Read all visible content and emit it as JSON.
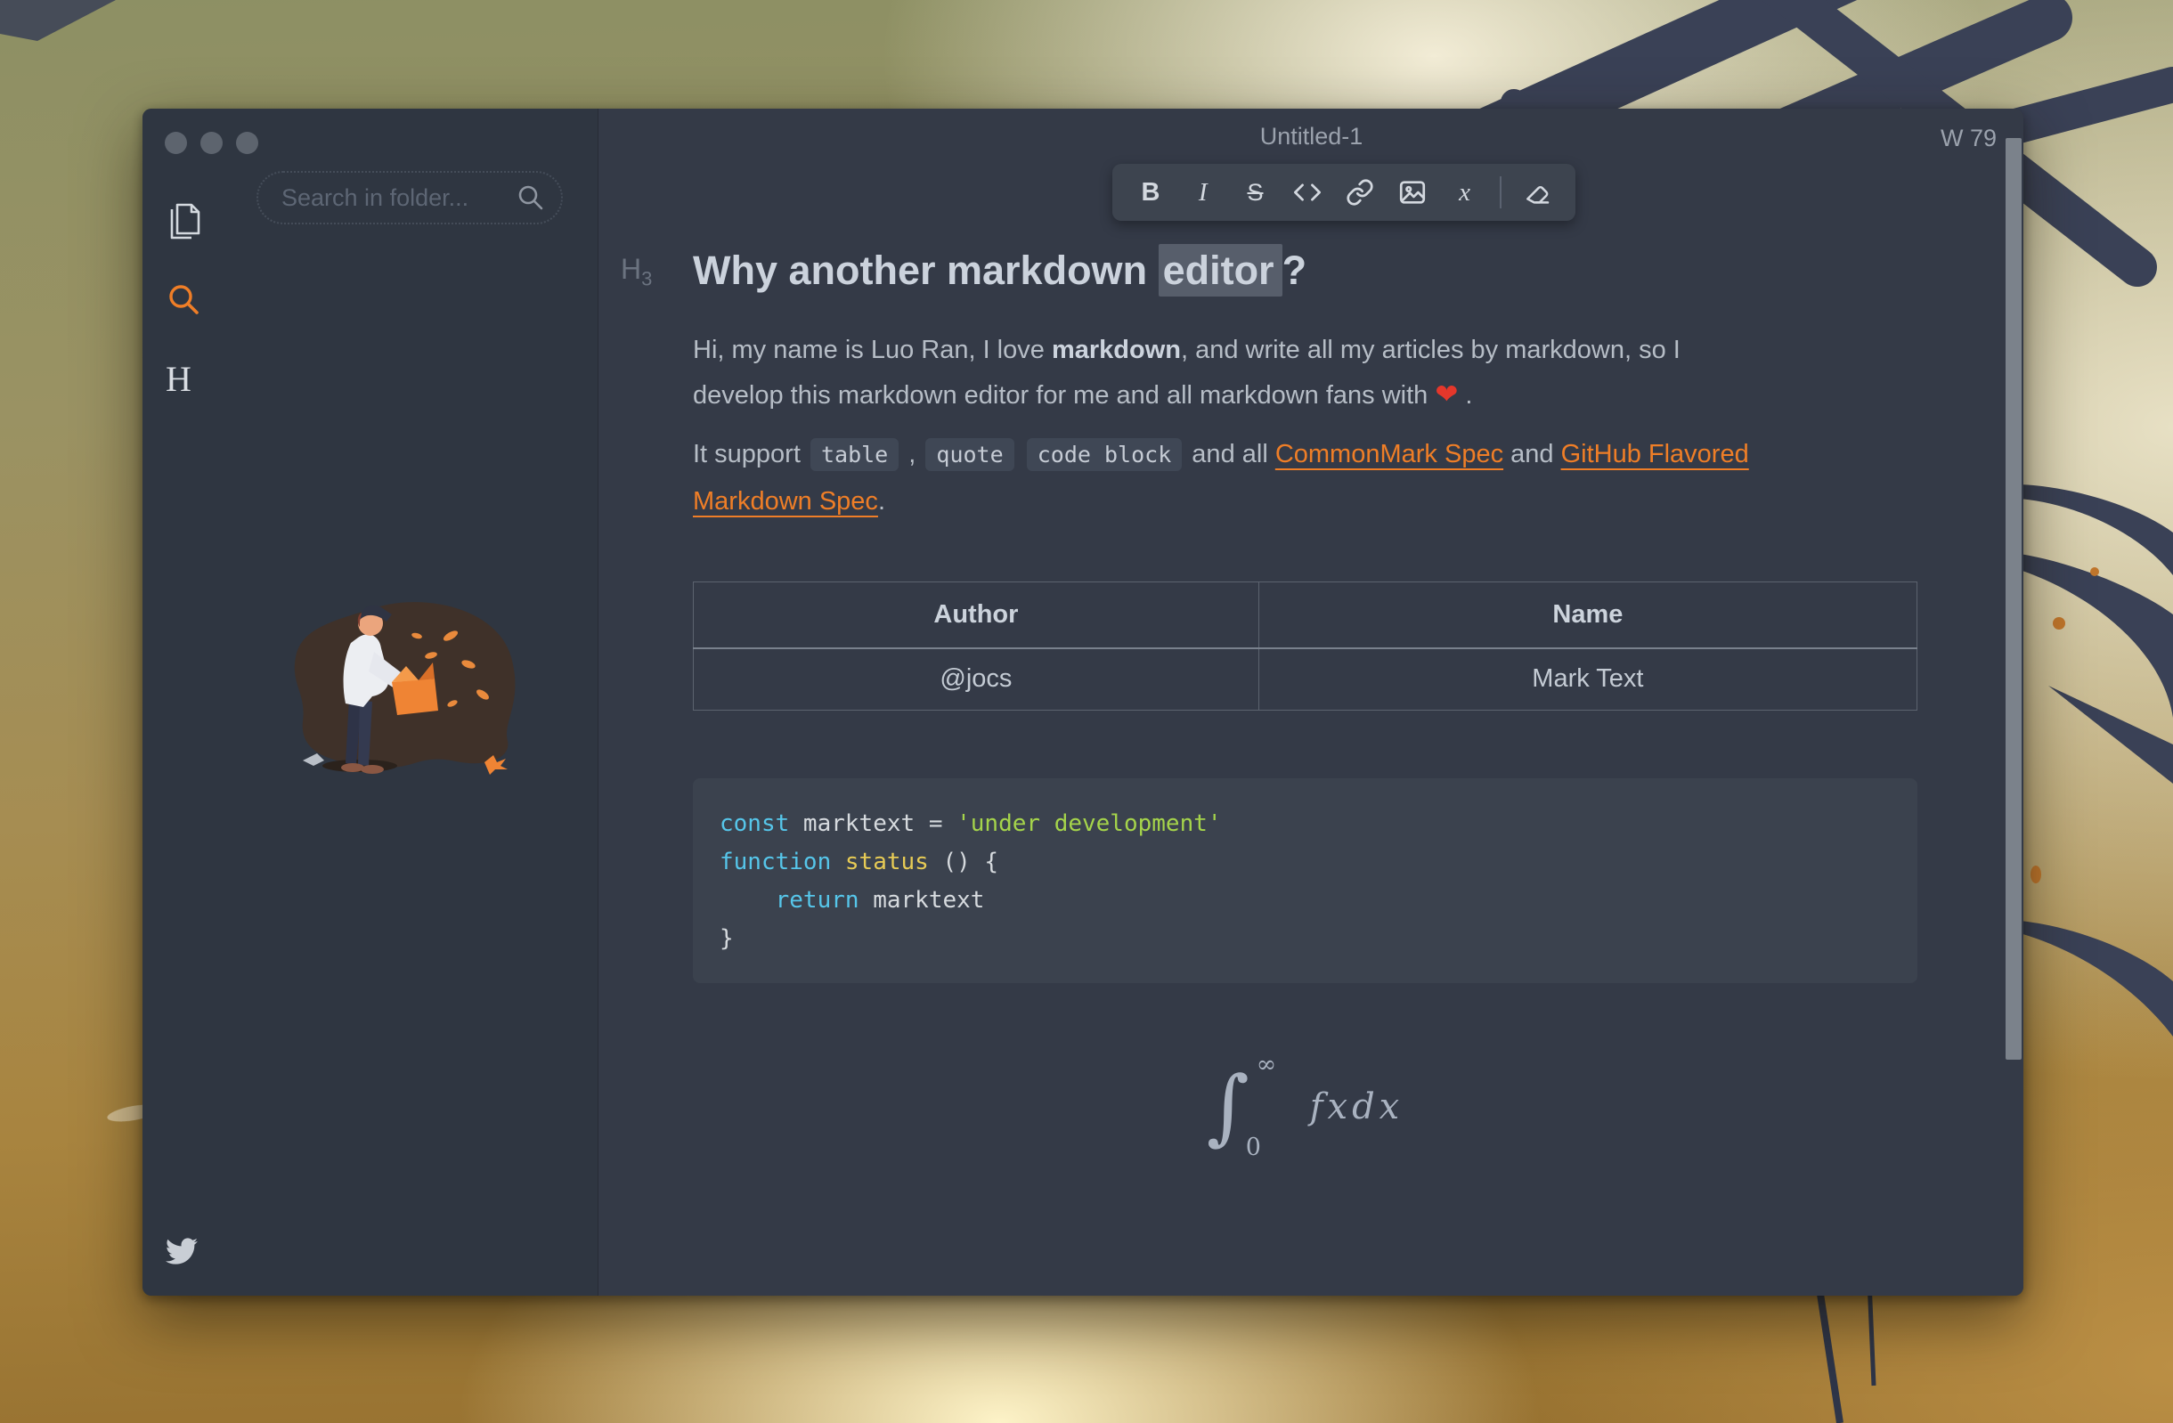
{
  "window": {
    "titlebar": {
      "title": "Untitled-1",
      "word_count": "W 79"
    },
    "sidebar": {
      "search": {
        "placeholder": "Search in folder..."
      },
      "icons": [
        "documents-icon",
        "search-icon",
        "heading-toc-icon",
        "twitter-icon"
      ],
      "heading_toc_glyph": "H"
    },
    "toolbar": {
      "icons": [
        "bold",
        "italic",
        "strikethrough",
        "inline-code",
        "link",
        "image",
        "inline-math",
        "clear-format"
      ],
      "bold": "B",
      "italic": "I",
      "strikethrough": "S",
      "inline_math": "x"
    },
    "document": {
      "heading": {
        "gutter": "H",
        "gutter_sub": "3",
        "text_before": "Why another markdown ",
        "selected": "editor",
        "text_after": "?"
      },
      "paragraph1": [
        {
          "t": "Hi, my name is Luo Ran, I love "
        },
        {
          "t": "markdown",
          "s": "b"
        },
        {
          "t": ", and write all my articles by markdown, so I"
        },
        {
          "br": true
        },
        {
          "t": "develop this markdown editor for me and all markdown fans with "
        },
        {
          "t": "❤",
          "s": "emoji"
        },
        {
          "t": " ."
        }
      ],
      "paragraph2": [
        {
          "t": "It support "
        },
        {
          "t": "table",
          "s": "code"
        },
        {
          "t": " , "
        },
        {
          "t": "quote",
          "s": "code"
        },
        {
          "t": " "
        },
        {
          "t": "code block",
          "s": "code"
        },
        {
          "t": " and all "
        },
        {
          "t": "CommonMark Spec",
          "s": "link"
        },
        {
          "t": " and "
        },
        {
          "t": "GitHub Flavored ",
          "s": "link"
        },
        {
          "br": true
        },
        {
          "t": "Markdown Spec",
          "s": "link"
        },
        {
          "t": "."
        }
      ],
      "table": {
        "headers": [
          "Author",
          "Name"
        ],
        "rows": [
          [
            "@jocs",
            "Mark Text"
          ]
        ]
      },
      "code": {
        "language": "javascript",
        "lines": [
          [
            {
              "t": "const",
              "c": "kw"
            },
            {
              "t": " marktext = ",
              "c": "pl"
            },
            {
              "t": "'under development'",
              "c": "str"
            }
          ],
          [
            {
              "t": "function",
              "c": "kw"
            },
            {
              "t": " ",
              "c": "pl"
            },
            {
              "t": "status",
              "c": "fn"
            },
            {
              "t": " () {",
              "c": "pl"
            }
          ],
          [
            {
              "t": "    ",
              "c": "pl"
            },
            {
              "t": "return",
              "c": "kw"
            },
            {
              "t": " marktext",
              "c": "pl"
            }
          ],
          [
            {
              "t": "}",
              "c": "pl"
            }
          ]
        ]
      },
      "math": {
        "integral": "∫",
        "upper": "∞",
        "lower": "0",
        "body": "fxdx"
      }
    },
    "colors": {
      "accent_link": "#ef7e27",
      "editor_bg": "#343a47",
      "sidebar_bg": "#2f3641",
      "code_keyword": "#56c6ea",
      "code_string": "#a5d44b",
      "code_function": "#e7cb55",
      "selection_bg": "#575e6b"
    }
  }
}
